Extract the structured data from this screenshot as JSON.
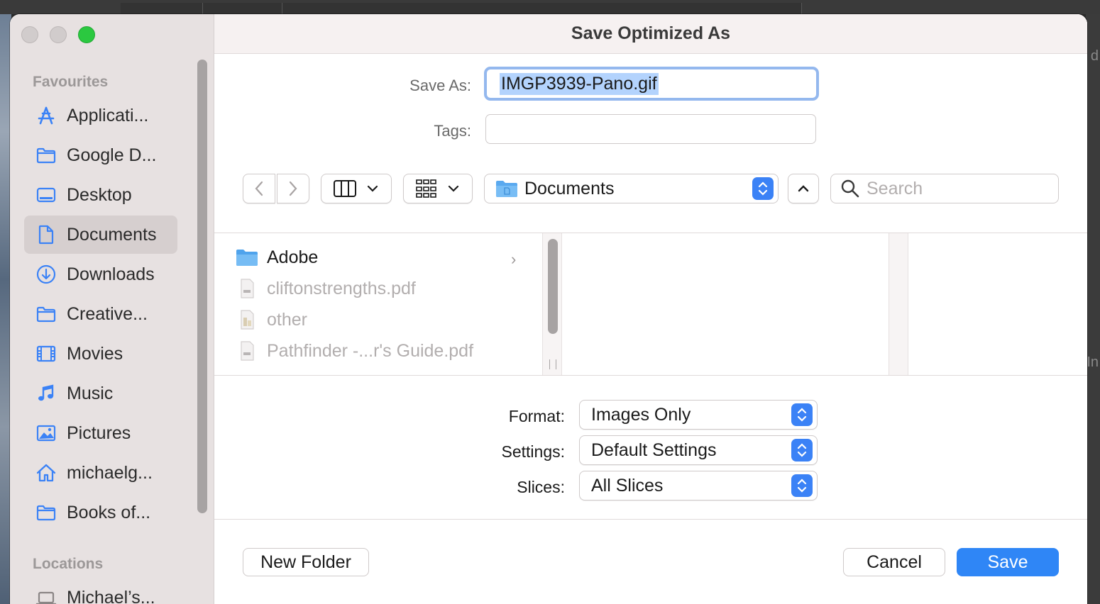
{
  "dialog": {
    "title": "Save Optimized As",
    "save_as_label": "Save As:",
    "save_as_value": "IMGP3939-Pano.gif",
    "tags_label": "Tags:",
    "tags_value": ""
  },
  "sidebar": {
    "favourites_heading": "Favourites",
    "locations_heading": "Locations",
    "items": [
      {
        "label": "Applicati...",
        "icon": "applications-icon"
      },
      {
        "label": "Google D...",
        "icon": "folder-icon"
      },
      {
        "label": "Desktop",
        "icon": "desktop-icon"
      },
      {
        "label": "Documents",
        "icon": "document-icon",
        "active": true
      },
      {
        "label": "Downloads",
        "icon": "download-icon"
      },
      {
        "label": "Creative...",
        "icon": "folder-icon"
      },
      {
        "label": "Movies",
        "icon": "film-icon"
      },
      {
        "label": "Music",
        "icon": "music-note-icon"
      },
      {
        "label": "Pictures",
        "icon": "picture-icon"
      },
      {
        "label": "michaelg...",
        "icon": "home-icon"
      },
      {
        "label": "Books of...",
        "icon": "folder-icon"
      }
    ],
    "locations": [
      {
        "label": "Michael’s...",
        "icon": "laptop-icon"
      }
    ]
  },
  "toolbar": {
    "location": "Documents",
    "search_placeholder": "Search"
  },
  "browser": {
    "files": [
      {
        "name": "Adobe",
        "kind": "folder"
      },
      {
        "name": "cliftonstrengths.pdf",
        "kind": "pdf"
      },
      {
        "name": "other",
        "kind": "file"
      },
      {
        "name": "Pathfinder -...r's Guide.pdf",
        "kind": "pdf"
      }
    ]
  },
  "options": {
    "format_label": "Format:",
    "format_value": "Images Only",
    "settings_label": "Settings:",
    "settings_value": "Default Settings",
    "slices_label": "Slices:",
    "slices_value": "All Slices"
  },
  "footer": {
    "new_folder": "New Folder",
    "cancel": "Cancel",
    "save": "Save"
  },
  "colors": {
    "accent": "#2f86f6",
    "sidebar_bg": "#e7e1e1",
    "sidebar_icon": "#3b82f6"
  }
}
